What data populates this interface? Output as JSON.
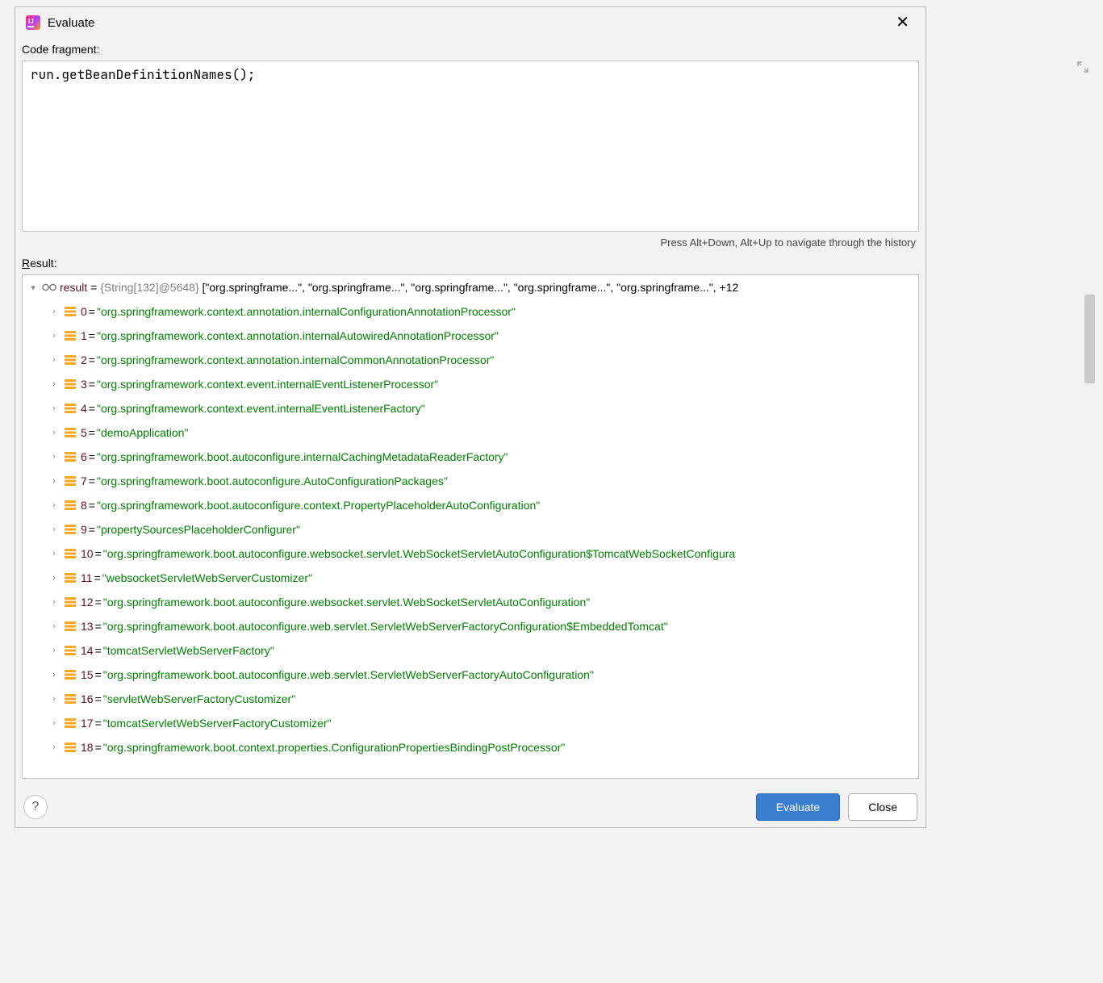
{
  "titlebar": {
    "title": "Evaluate",
    "close": "✕"
  },
  "labels": {
    "code_fragment": "Code fragment:",
    "result": "Result:",
    "result_underline": "R"
  },
  "code_fragment": {
    "value": "run.getBeanDefinitionNames();"
  },
  "hint": "Press Alt+Down, Alt+Up to navigate through the history",
  "result_root": {
    "var": "result",
    "type": "{String[132]@5648}",
    "preview": "[\"org.springframe...\", \"org.springframe...\", \"org.springframe...\", \"org.springframe...\", \"org.springframe...\", +12"
  },
  "items": [
    {
      "idx": "0",
      "val": "\"org.springframework.context.annotation.internalConfigurationAnnotationProcessor\""
    },
    {
      "idx": "1",
      "val": "\"org.springframework.context.annotation.internalAutowiredAnnotationProcessor\""
    },
    {
      "idx": "2",
      "val": "\"org.springframework.context.annotation.internalCommonAnnotationProcessor\""
    },
    {
      "idx": "3",
      "val": "\"org.springframework.context.event.internalEventListenerProcessor\""
    },
    {
      "idx": "4",
      "val": "\"org.springframework.context.event.internalEventListenerFactory\""
    },
    {
      "idx": "5",
      "val": "\"demoApplication\""
    },
    {
      "idx": "6",
      "val": "\"org.springframework.boot.autoconfigure.internalCachingMetadataReaderFactory\""
    },
    {
      "idx": "7",
      "val": "\"org.springframework.boot.autoconfigure.AutoConfigurationPackages\""
    },
    {
      "idx": "8",
      "val": "\"org.springframework.boot.autoconfigure.context.PropertyPlaceholderAutoConfiguration\""
    },
    {
      "idx": "9",
      "val": "\"propertySourcesPlaceholderConfigurer\""
    },
    {
      "idx": "10",
      "val": "\"org.springframework.boot.autoconfigure.websocket.servlet.WebSocketServletAutoConfiguration$TomcatWebSocketConfigura"
    },
    {
      "idx": "11",
      "val": "\"websocketServletWebServerCustomizer\""
    },
    {
      "idx": "12",
      "val": "\"org.springframework.boot.autoconfigure.websocket.servlet.WebSocketServletAutoConfiguration\""
    },
    {
      "idx": "13",
      "val": "\"org.springframework.boot.autoconfigure.web.servlet.ServletWebServerFactoryConfiguration$EmbeddedTomcat\""
    },
    {
      "idx": "14",
      "val": "\"tomcatServletWebServerFactory\""
    },
    {
      "idx": "15",
      "val": "\"org.springframework.boot.autoconfigure.web.servlet.ServletWebServerFactoryAutoConfiguration\""
    },
    {
      "idx": "16",
      "val": "\"servletWebServerFactoryCustomizer\""
    },
    {
      "idx": "17",
      "val": "\"tomcatServletWebServerFactoryCustomizer\""
    },
    {
      "idx": "18",
      "val": "\"org.springframework.boot.context.properties.ConfigurationPropertiesBindingPostProcessor\""
    }
  ],
  "buttons": {
    "help": "?",
    "evaluate": "Evaluate",
    "close": "Close"
  }
}
